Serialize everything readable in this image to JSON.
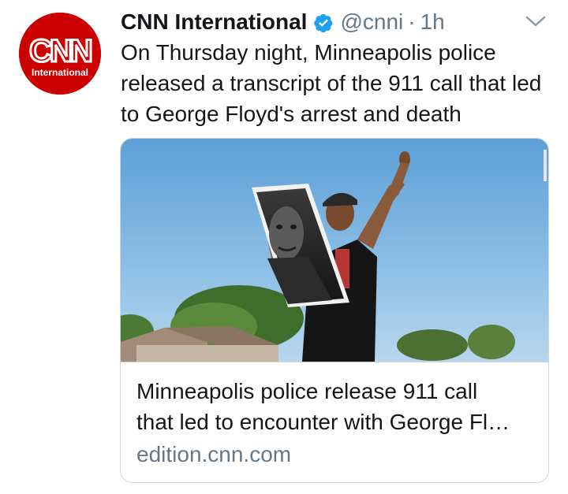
{
  "tweet": {
    "author": {
      "display_name": "CNN International",
      "handle": "@cnni",
      "verified": true,
      "avatar": {
        "logo_text": "CNN",
        "sub_text": "International",
        "color": "#cc0000"
      }
    },
    "separator": "·",
    "time": "1h",
    "text": "On Thursday night, Minneapolis police released a transcript of the 911 call that led to George Floyd's arrest and death",
    "more_icon": "chevron-down-icon",
    "card": {
      "title": "Minneapolis police release 911 call\nthat led to encounter with George Fl…",
      "domain": "edition.cnn.com"
    }
  },
  "colors": {
    "text": "#14171a",
    "secondary": "#657786",
    "verified_blue": "#1da1f2",
    "border": "#ccd6dd",
    "cnn_red": "#cc0000"
  }
}
